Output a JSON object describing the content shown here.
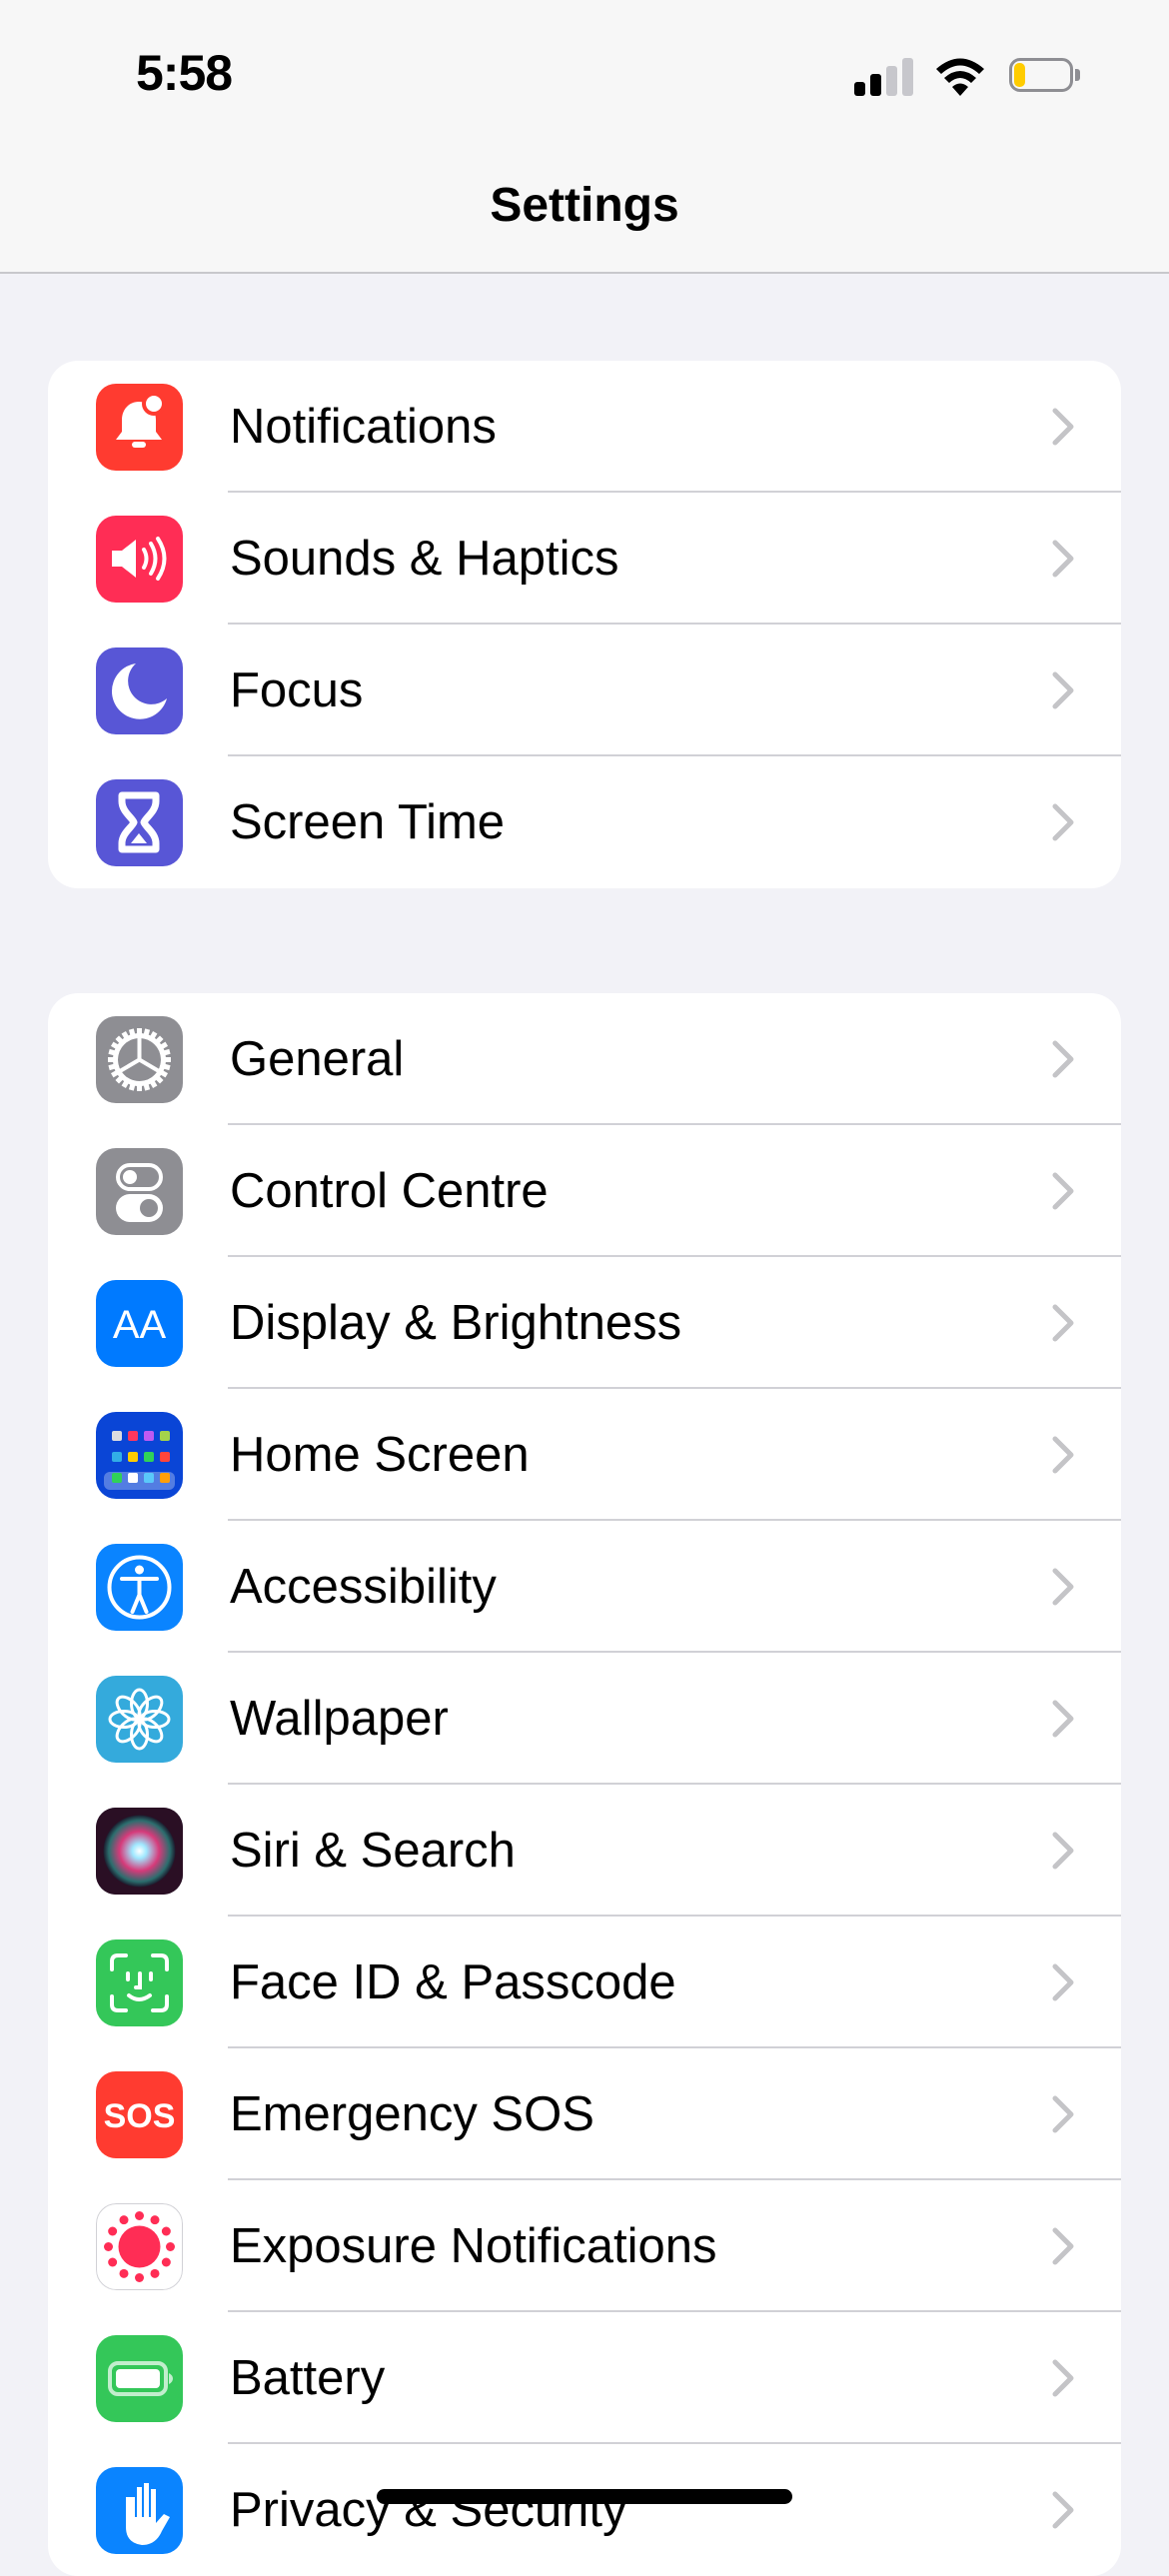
{
  "status_bar": {
    "time": "5:58",
    "signal_bars_active": 2,
    "signal_bars_total": 4,
    "wifi": "connected",
    "battery_level_percent": 20,
    "battery_color": "#ffcc00"
  },
  "nav": {
    "title": "Settings"
  },
  "groups": [
    {
      "items": [
        {
          "label": "Notifications",
          "icon": "bell-badge-icon",
          "color": "#ff3b30"
        },
        {
          "label": "Sounds & Haptics",
          "icon": "speaker-wave-icon",
          "color": "#ff2d55"
        },
        {
          "label": "Focus",
          "icon": "moon-icon",
          "color": "#5856d6"
        },
        {
          "label": "Screen Time",
          "icon": "hourglass-icon",
          "color": "#5856d6"
        }
      ]
    },
    {
      "items": [
        {
          "label": "General",
          "icon": "gear-icon",
          "color": "#8e8e93"
        },
        {
          "label": "Control Centre",
          "icon": "toggles-icon",
          "color": "#8e8e93"
        },
        {
          "label": "Display & Brightness",
          "icon": "text-size-icon",
          "color": "#007aff",
          "glyph": "AA"
        },
        {
          "label": "Home Screen",
          "icon": "app-grid-icon",
          "color": "#0a45d6"
        },
        {
          "label": "Accessibility",
          "icon": "accessibility-icon",
          "color": "#0a84ff"
        },
        {
          "label": "Wallpaper",
          "icon": "flower-icon",
          "color": "#34aadc"
        },
        {
          "label": "Siri & Search",
          "icon": "siri-orb-icon",
          "color": "#1c1c2e"
        },
        {
          "label": "Face ID & Passcode",
          "icon": "face-id-icon",
          "color": "#34c759"
        },
        {
          "label": "Emergency SOS",
          "icon": "sos-icon",
          "color": "#ff3b30",
          "glyph": "SOS"
        },
        {
          "label": "Exposure Notifications",
          "icon": "exposure-icon",
          "color": "#ffffff"
        },
        {
          "label": "Battery",
          "icon": "battery-icon",
          "color": "#34c759"
        },
        {
          "label": "Privacy & Security",
          "icon": "hand-icon",
          "color": "#0a84ff"
        }
      ]
    }
  ]
}
